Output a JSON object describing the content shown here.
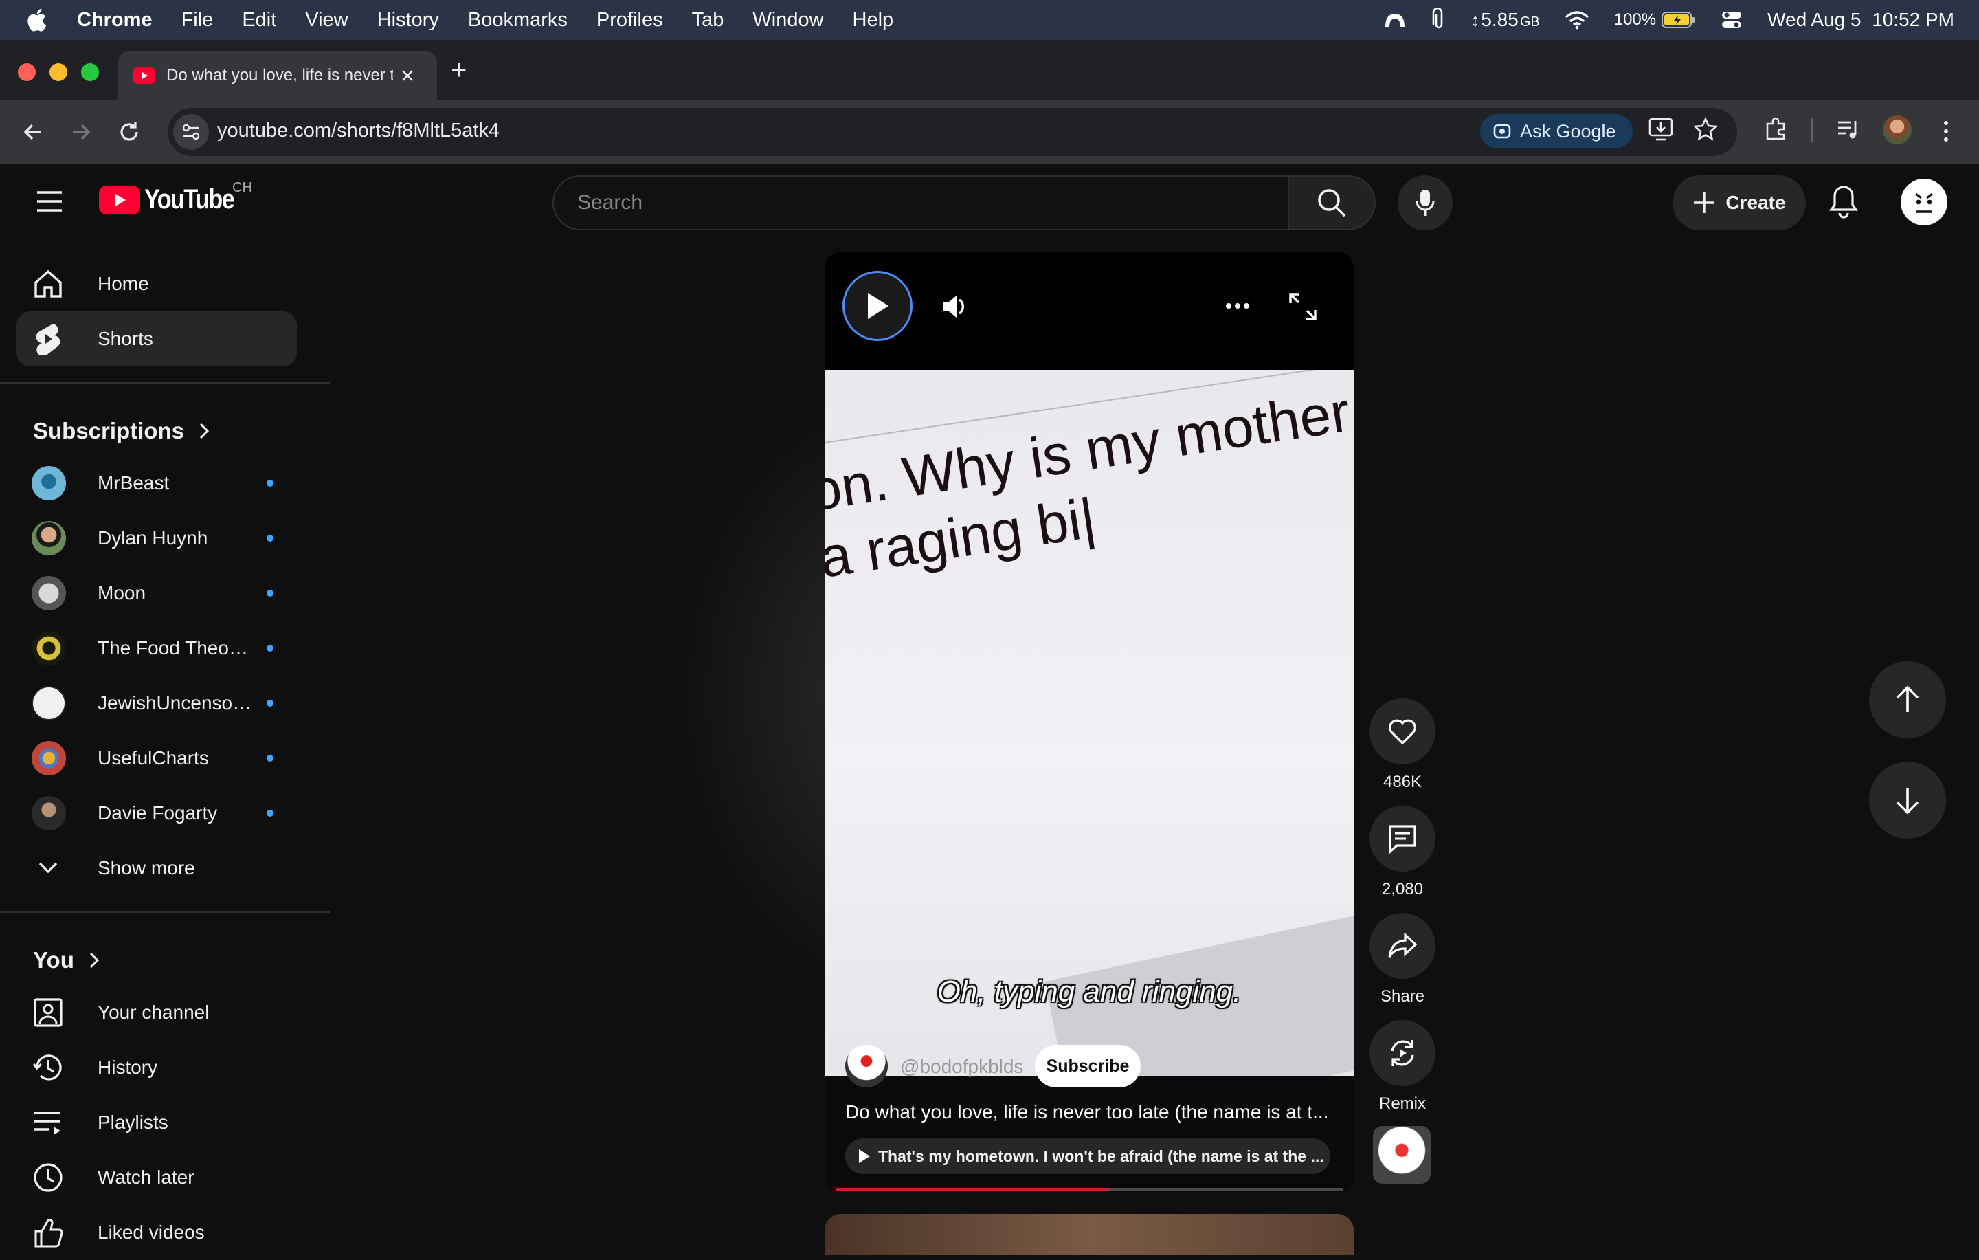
{
  "menubar": {
    "app_name": "Chrome",
    "items": [
      "File",
      "Edit",
      "View",
      "History",
      "Bookmarks",
      "Profiles",
      "Tab",
      "Window",
      "Help"
    ],
    "memory": "5.85",
    "memory_unit": "GB",
    "battery_percent": "100%",
    "datetime": "Wed Aug 5  10:52 PM"
  },
  "browser": {
    "tab_title": "Do what you love, life is never too late",
    "new_tab_symbol": "+",
    "url": "youtube.com/shorts/f8MltL5atk4",
    "ask_google_label": "Ask Google"
  },
  "youtube": {
    "logo_text": "YouTube",
    "country_code": "CH",
    "search_placeholder": "Search",
    "create_label": "Create"
  },
  "sidebar": {
    "main": [
      {
        "label": "Home",
        "icon": "home-icon"
      },
      {
        "label": "Shorts",
        "icon": "shorts-icon",
        "active": true
      }
    ],
    "subscriptions_heading": "Subscriptions",
    "subscriptions": [
      {
        "label": "MrBeast",
        "color": "#6fb7d9"
      },
      {
        "label": "Dylan Huynh",
        "color": "#6b8a5a"
      },
      {
        "label": "Moon",
        "color": "#9a9a9a"
      },
      {
        "label": "The Food Theorists",
        "color": "#2a2a10"
      },
      {
        "label": "JewishUncensored",
        "color": "#e8e8e8"
      },
      {
        "label": "UsefulCharts",
        "color": "#c0453a"
      },
      {
        "label": "Davie Fogarty",
        "color": "#3a3a3a"
      }
    ],
    "show_more": "Show more",
    "you_heading": "You",
    "you_items": [
      {
        "label": "Your channel",
        "icon": "person-icon"
      },
      {
        "label": "History",
        "icon": "history-icon"
      },
      {
        "label": "Playlists",
        "icon": "playlists-icon"
      },
      {
        "label": "Watch later",
        "icon": "clock-icon"
      },
      {
        "label": "Liked videos",
        "icon": "thumbs-up-icon"
      }
    ]
  },
  "short": {
    "typed_line_1": "on. Why is my mother",
    "typed_line_2": "a raging bi|",
    "caption": "Oh, typing and ringing.",
    "channel_handle": "@bodofpkblds",
    "subscribe_label": "Subscribe",
    "title": "Do what you love, life is never too late (the name is at t...",
    "related": "That's my hometown. I won't be afraid (the name is at the ...",
    "progress": 0.54
  },
  "actions": {
    "likes": "486K",
    "comments": "2,080",
    "share_label": "Share",
    "remix_label": "Remix"
  },
  "colors": {
    "accent_red": "#ff0033",
    "progress_red": "#cc1f35",
    "dot_blue": "#3ea6ff"
  }
}
